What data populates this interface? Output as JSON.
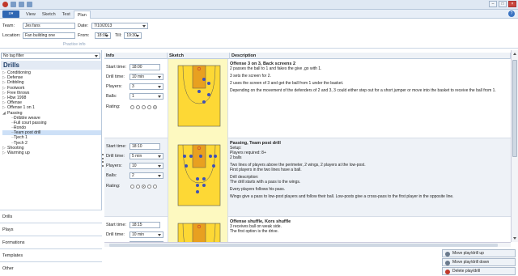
{
  "ribbon": {
    "app_button": "▾",
    "tabs": [
      "View",
      "Sketch",
      "Test",
      "Plan"
    ]
  },
  "practice": {
    "team_label": "Team:",
    "team_value": "Jes fans",
    "location_label": "Location:",
    "location_value": "Fan building one",
    "date_label": "Date:",
    "date_value": "7/10/2013",
    "from_label": "From:",
    "from_value": "18:00",
    "till_label": "Till:",
    "till_value": "19:30",
    "group_label": "Practice info"
  },
  "left": {
    "filter": "No tag filter",
    "header": "Drills",
    "tree": [
      {
        "label": "Conditioning",
        "type": "group"
      },
      {
        "label": "Defense",
        "type": "group"
      },
      {
        "label": "Dribbling",
        "type": "group"
      },
      {
        "label": "Footwork",
        "type": "group"
      },
      {
        "label": "Free throws",
        "type": "group"
      },
      {
        "label": "Hbw 1998",
        "type": "group"
      },
      {
        "label": "Offense",
        "type": "group"
      },
      {
        "label": "Offense 1 on 1",
        "type": "group"
      },
      {
        "label": "Passing",
        "type": "open"
      },
      {
        "label": "Dribble weave",
        "type": "child"
      },
      {
        "label": "Full court passing",
        "type": "child"
      },
      {
        "label": "Rondo",
        "type": "child"
      },
      {
        "label": "Team post drill",
        "type": "selected"
      },
      {
        "label": "Tjech 1",
        "type": "child"
      },
      {
        "label": "Tjech 2",
        "type": "child"
      },
      {
        "label": "Shooting",
        "type": "group"
      },
      {
        "label": "Warming up",
        "type": "group"
      }
    ],
    "nav": [
      "Drills",
      "Plays",
      "Formations",
      "Templates",
      "Other"
    ]
  },
  "grid": {
    "headers": [
      "Info",
      "Sketch",
      "Description"
    ],
    "labels": {
      "start": "Start time:",
      "drill": "Drill time:",
      "players": "Players:",
      "balls": "Balls:",
      "rating": "Rating:"
    },
    "rows": [
      {
        "start": "18:00",
        "drill": "10 min",
        "players": "3",
        "balls": "1",
        "rating": 5,
        "title": "Offense 3 on 3, Back screens 2",
        "lines": [
          "2 passes the ball to 1 and fakes the give ,go with 1.",
          "3 sets the screen for 2.",
          "2 uses the screen of 3 and get the ball from 1 under the basket.",
          "Depending on the movement of the defenders of 2 and 3, 3 could either step out for a short jumper or move into the basket to receive the ball from 1."
        ]
      },
      {
        "start": "18:10",
        "drill": "5 min",
        "players": "10",
        "balls": "2",
        "rating": 3,
        "title": "Passing, Team post drill",
        "lines": [
          "Setup:\nPlayers required: 8+\n2 balls",
          "Two lines of players above the perimeter, 2 wings, 2 players at the low-post.\nFirst players in the two lines have a ball.",
          "Drill description:\nThe drill starts with a pass to the wings.",
          "Every players follows his pass.",
          "Wings give a pass to low-post players and follow their ball. Low-posts give a cross-pass to the first player in the opposite line."
        ]
      },
      {
        "start": "18:15",
        "drill": "10 min",
        "players": "5",
        "balls": "",
        "rating": 0,
        "title": "Offense shuffle, Kors shuffle",
        "lines": [
          "3 receives ball on weak side.\nThe first option is the drive."
        ]
      }
    ]
  },
  "actions": {
    "up": "Move play/drill up",
    "down": "Move play/drill down",
    "delete": "Delete play/drill"
  },
  "colors": {
    "accent": "#2f67b3",
    "court": "#fdd835",
    "player": "#3f51b5"
  }
}
